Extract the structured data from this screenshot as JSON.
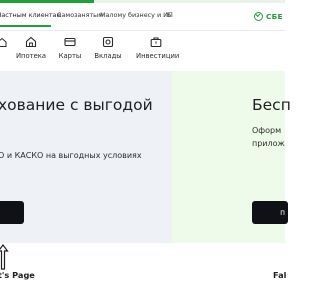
{
  "progress": {
    "fraction": 0.33,
    "color": "#21a038"
  },
  "topnav": {
    "items": [
      "Частным клиентам",
      "Самозанятым",
      "Малому бизнесу и ИП",
      "Б"
    ],
    "active_index": 0
  },
  "logo": {
    "text": "СБЕ",
    "icon": "sber-check-icon"
  },
  "categories": [
    {
      "label": "",
      "icon": "home-icon"
    },
    {
      "label": "Ипотека",
      "icon": "house-icon"
    },
    {
      "label": "Карты",
      "icon": "card-icon"
    },
    {
      "label": "Вклады",
      "icon": "deposit-icon"
    },
    {
      "label": "Инвестиции",
      "icon": "briefcase-icon"
    }
  ],
  "banners": [
    {
      "title": "хование с выгодой",
      "text": "О и КАСКО на выгодных условиях",
      "button": "",
      "background": "#eef2f6"
    },
    {
      "title": "Бесп",
      "text_lines": [
        "Оформ",
        "прилож"
      ],
      "button": "п",
      "background": "#effbea"
    }
  ],
  "captions": {
    "left": "t's Page",
    "right": "Fal"
  }
}
